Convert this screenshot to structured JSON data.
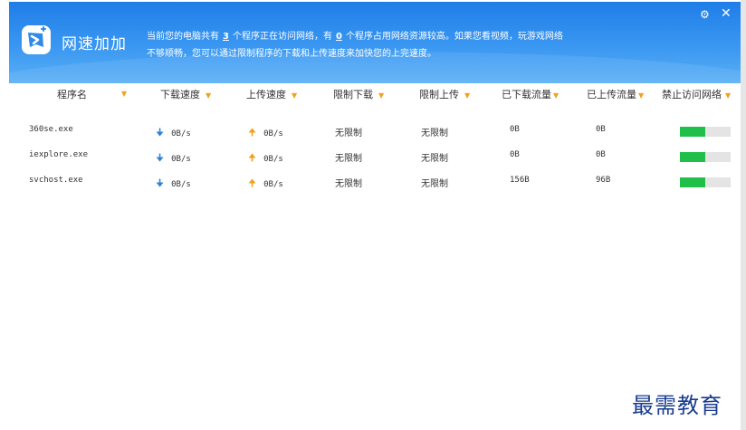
{
  "app": {
    "title": "网速加加",
    "message_part1": "当前您的电脑共有",
    "program_count": "3",
    "message_part2": "个程序正在访问网络，有",
    "heavy_count": "0",
    "message_part3": "个程序占用网络资源较高。如果您看视频，玩游戏网络",
    "message_line2": "不够顺畅，您可以通过限制程序的下载和上传速度来加快您的上完速度。",
    "close_symbol": "✕",
    "settings_symbol": "⚙"
  },
  "table": {
    "columns": [
      "程序名",
      "下载速度",
      "上传速度",
      "限制下载",
      "限制上传",
      "已下载流量",
      "已上传流量",
      "禁止访问网络"
    ],
    "rows": [
      {
        "name": "360se.exe",
        "download": "0B/s",
        "upload": "0B/s",
        "limit_down": "无限制",
        "limit_up": "无限制",
        "downloaded": "0B",
        "uploaded": "0B",
        "block_level": 0.5
      },
      {
        "name": "iexplore.exe",
        "download": "0B/s",
        "upload": "0B/s",
        "limit_down": "无限制",
        "limit_up": "无限制",
        "downloaded": "0B",
        "uploaded": "0B",
        "block_level": 0.5
      },
      {
        "name": "svchost.exe",
        "download": "0B/s",
        "upload": "0B/s",
        "limit_down": "无限制",
        "limit_up": "无限制",
        "downloaded": "156B",
        "uploaded": "96B",
        "block_level": 0.5
      }
    ]
  },
  "icons": {
    "sort": "sort-triangle-icon",
    "down_arrow": "download-arrow-icon",
    "up_arrow": "upload-arrow-icon"
  },
  "colors": {
    "header": "#2f8ae8",
    "accent_orange": "#f2a01e",
    "download_blue": "#2f80d8",
    "block_green": "#1fbf4a"
  },
  "watermark": "最需教育"
}
